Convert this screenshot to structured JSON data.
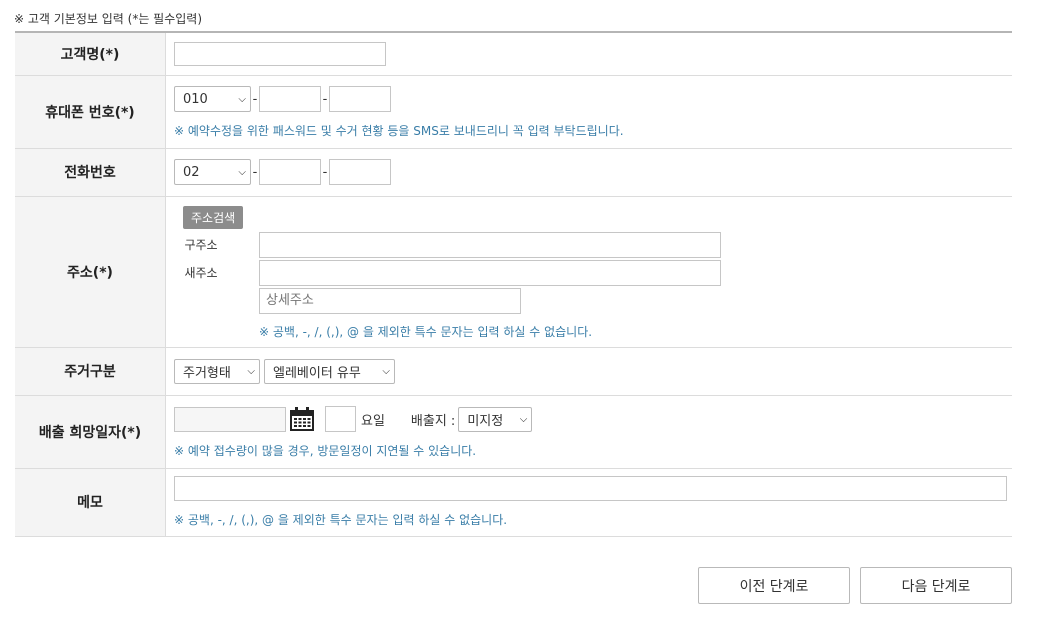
{
  "section_title": "※ 고객 기본정보 입력 (*는 필수입력)",
  "rows": {
    "name": {
      "label": "고객명(*)",
      "value": ""
    },
    "mobile": {
      "label": "휴대폰 번호(*)",
      "prefix": "010",
      "mid": "",
      "last": "",
      "note": "※ 예약수정을 위한 패스워드 및 수거 현황 등을 SMS로 보내드리니 꼭 입력 부탁드립니다."
    },
    "phone": {
      "label": "전화번호",
      "prefix": "02",
      "mid": "",
      "last": ""
    },
    "address": {
      "label": "주소(*)",
      "search_button": "주소검색",
      "old_label": "구주소",
      "new_label": "새주소",
      "old_value": "",
      "new_value": "",
      "detail_placeholder": "상세주소",
      "note": "※ 공백, -, /, (,), @ 을 제외한 특수 문자는 입력 하실 수 없습니다."
    },
    "residence": {
      "label": "주거구분",
      "type_select": "주거형태",
      "elevator_select": "엘레베이터 유무"
    },
    "pickup": {
      "label": "배출 희망일자(*)",
      "date_value": "",
      "day_value": "",
      "day_suffix": "요일",
      "place_label": "배출지 :",
      "place_select": "미지정",
      "note": "※ 예약 접수량이 많을 경우, 방문일정이 지연될 수 있습니다."
    },
    "memo": {
      "label": "메모",
      "value": "",
      "note": "※ 공백, -, /, (,), @ 을 제외한 특수 문자는 입력 하실 수 없습니다."
    }
  },
  "buttons": {
    "prev": "이전 단계로",
    "next": "다음 단계로"
  },
  "colors": {
    "note": "#3a7ea8",
    "header_bg": "#f4f4f4",
    "button_gray": "#8c8c8c"
  }
}
